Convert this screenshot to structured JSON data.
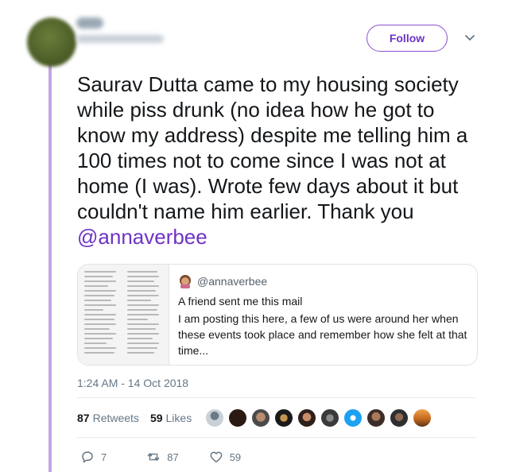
{
  "header": {
    "follow_label": "Follow",
    "menu_icon": "chevron-down-icon"
  },
  "tweet": {
    "text_main": "Saurav Dutta came to my housing society while piss drunk (no idea how he got to know my address) despite me telling him a 100 times not to come since I was not at home (I was). Wrote few days about it but couldn't name him earlier. Thank you ",
    "mention": "@annaverbee",
    "timestamp": "1:24 AM - 14 Oct 2018"
  },
  "quote": {
    "handle": "@annaverbee",
    "title": "A friend sent me this mail",
    "body": "I am posting this here, a few of us were around her when these events took place and remember how she felt at that time...",
    "avatar_icon": "woman-emoji-icon"
  },
  "stats": {
    "retweets_count": "87",
    "retweets_label": "Retweets",
    "likes_count": "59",
    "likes_label": "Likes"
  },
  "actions": {
    "reply_count": "7",
    "retweet_count": "87",
    "like_count": "59"
  },
  "colors": {
    "accent": "#6f33c4",
    "thread_line": "#c3a6e8",
    "muted": "#657786"
  }
}
